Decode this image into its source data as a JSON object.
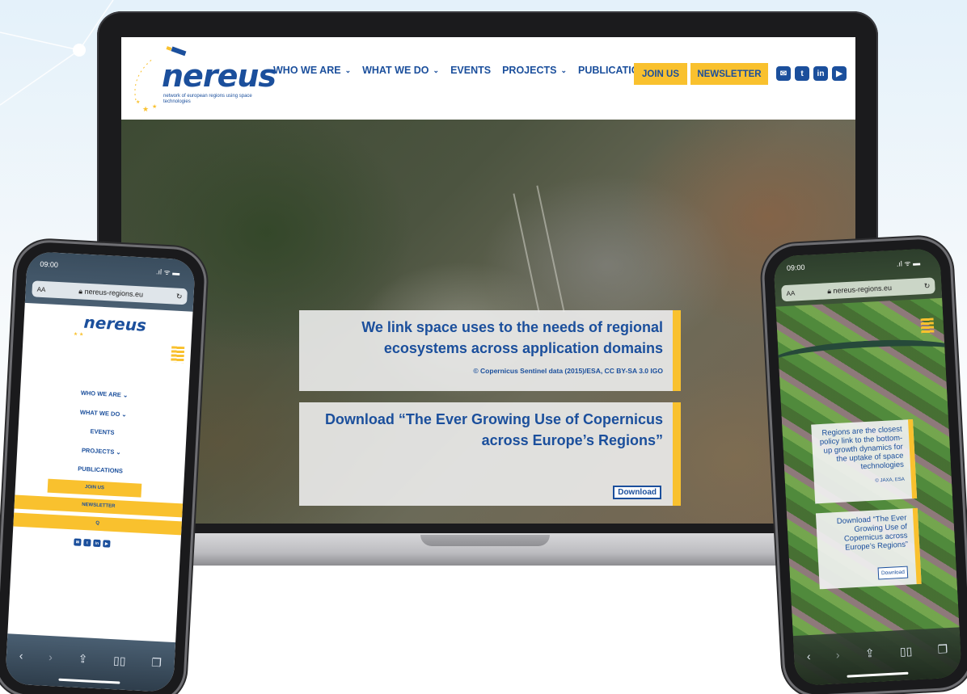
{
  "desktop": {
    "logo": {
      "word": "nereus",
      "tagline": "network of european regions using space technologies"
    },
    "nav": [
      {
        "label": "WHO WE ARE",
        "has_dropdown": true
      },
      {
        "label": "WHAT WE DO",
        "has_dropdown": true
      },
      {
        "label": "EVENTS",
        "has_dropdown": false
      },
      {
        "label": "PROJECTS",
        "has_dropdown": true
      },
      {
        "label": "PUBLICATIONS",
        "has_dropdown": false
      }
    ],
    "join_label": "JOIN US",
    "newsletter_label": "NEWSLETTER",
    "social_icons": [
      "email-icon",
      "twitter-icon",
      "linkedin-icon",
      "youtube-icon"
    ],
    "hero": {
      "headline": "We link space uses to the needs of regional ecosystems across application domains",
      "credit": "© Copernicus Sentinel data (2015)/ESA, CC BY-SA 3.0 IGO",
      "download_title": "Download “The Ever Growing Use of Copernicus across Europe’s Regions”",
      "download_button": "Download"
    }
  },
  "phone_left": {
    "time": "09:00",
    "text_size": "AA",
    "url": "nereus-regions.eu",
    "menu": [
      {
        "label": "WHO WE ARE",
        "has_dropdown": true
      },
      {
        "label": "WHAT WE DO",
        "has_dropdown": true
      },
      {
        "label": "EVENTS",
        "has_dropdown": false
      },
      {
        "label": "PROJECTS",
        "has_dropdown": true
      },
      {
        "label": "PUBLICATIONS",
        "has_dropdown": false
      }
    ],
    "join_label": "JOIN US",
    "newsletter_label": "NEWSLETTER",
    "search_label": "Q"
  },
  "phone_right": {
    "time": "09:00",
    "text_size": "AA",
    "url": "nereus-regions.eu",
    "headline": "Regions are the closest policy link to the bottom-up growth dynamics for the uptake of space technologies",
    "credit": "© JAXA, ESA",
    "download_title": "Download “The Ever Growing Use of Copernicus across Europe’s Regions”",
    "download_button": "Download"
  },
  "colors": {
    "brand_blue": "#1b4f9c",
    "accent_yellow": "#f9c12e"
  }
}
